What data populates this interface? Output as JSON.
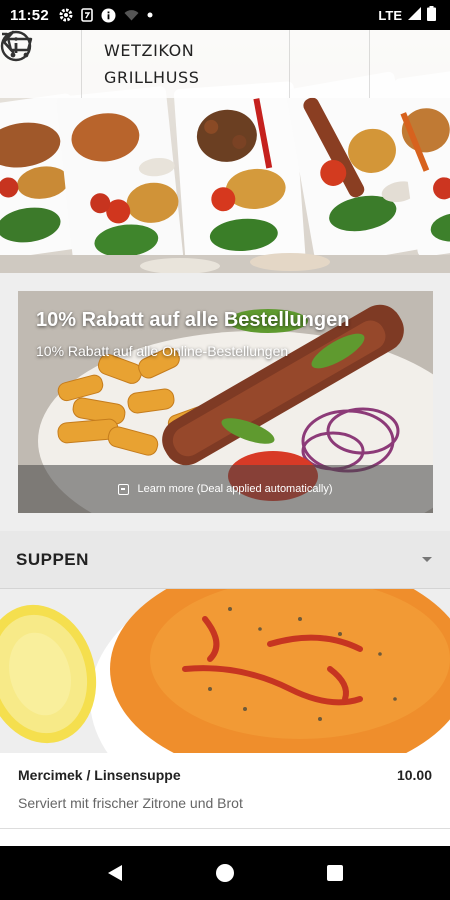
{
  "status_bar": {
    "time": "11:52",
    "network": "LTE"
  },
  "header": {
    "title": "WETZIKON\nGRILLHUSS"
  },
  "promo": {
    "title": "10% Rabatt auf alle Bestellungen",
    "subtitle": "10% Rabatt auf alle Online-Bestellungen",
    "learn_more": "Learn more (Deal applied automatically)"
  },
  "category": {
    "title": "SUPPEN"
  },
  "item": {
    "name": "Mercimek / Linsensuppe",
    "price": "10.00",
    "description": "Serviert mit frischer Zitrone und Brot"
  },
  "colors": {
    "soup": "#f0922e",
    "lemon": "#f3d94a",
    "accent_red": "#c72f2a"
  }
}
